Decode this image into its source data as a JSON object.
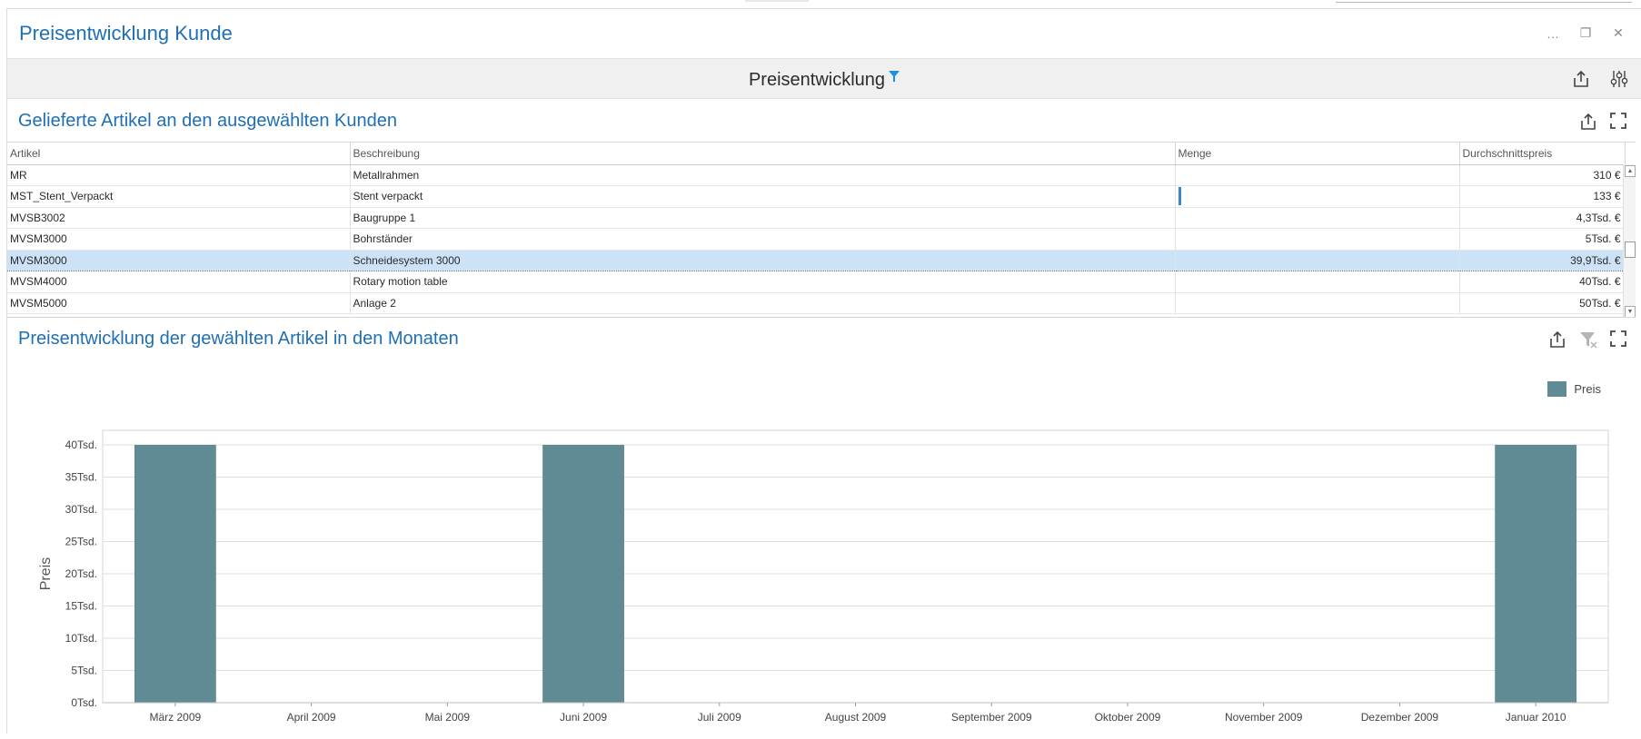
{
  "window": {
    "title": "Preisentwicklung Kunde",
    "controls": [
      "…",
      "❐",
      "✕"
    ]
  },
  "dashboard": {
    "title": "Preisentwicklung",
    "icons": [
      "filter-icon",
      "export-icon",
      "parameters-icon"
    ]
  },
  "grid_panel": {
    "title": "Gelieferte Artikel an den ausgewählten Kunden",
    "columns": [
      "Artikel",
      "Beschreibung",
      "Menge",
      "Durchschnittspreis"
    ],
    "rows": [
      {
        "artikel": "MR",
        "beschreibung": "Metallrahmen",
        "menge": "",
        "preis": "310 €",
        "menge_bar": false,
        "selected": false
      },
      {
        "artikel": "MST_Stent_Verpackt",
        "beschreibung": "Stent verpackt",
        "menge": "",
        "preis": "133 €",
        "menge_bar": true,
        "selected": false
      },
      {
        "artikel": "MVSB3002",
        "beschreibung": "Baugruppe 1",
        "menge": "",
        "preis": "4,3Tsd. €",
        "menge_bar": false,
        "selected": false
      },
      {
        "artikel": "MVSM3000",
        "beschreibung": "Bohrständer",
        "menge": "",
        "preis": "5Tsd. €",
        "menge_bar": false,
        "selected": false
      },
      {
        "artikel": "MVSM3000",
        "beschreibung": "Schneidesystem 3000",
        "menge": "",
        "preis": "39,9Tsd. €",
        "menge_bar": false,
        "selected": true
      },
      {
        "artikel": "MVSM4000",
        "beschreibung": "Rotary motion table",
        "menge": "",
        "preis": "40Tsd. €",
        "menge_bar": false,
        "selected": false
      },
      {
        "artikel": "MVSM5000",
        "beschreibung": "Anlage 2",
        "menge": "",
        "preis": "50Tsd. €",
        "menge_bar": false,
        "selected": false
      }
    ]
  },
  "chart_panel": {
    "title": "Preisentwicklung der gewählten Artikel in den Monaten"
  },
  "colors": {
    "accent": "#1f6fb4",
    "bar": "#608b94",
    "selection": "#cce3f7"
  },
  "chart_data": {
    "type": "bar",
    "categories": [
      "März 2009",
      "April 2009",
      "Mai 2009",
      "Juni 2009",
      "Juli 2009",
      "August 2009",
      "September 2009",
      "Oktober 2009",
      "November 2009",
      "Dezember 2009",
      "Januar 2010"
    ],
    "series": [
      {
        "name": "Preis",
        "values": [
          40000,
          null,
          null,
          40000,
          null,
          null,
          null,
          null,
          null,
          null,
          40000
        ]
      }
    ],
    "title": "",
    "xlabel": "",
    "ylabel": "Preis",
    "ylim": [
      0,
      40000
    ],
    "yticks": [
      0,
      5000,
      10000,
      15000,
      20000,
      25000,
      30000,
      35000,
      40000
    ],
    "ytick_labels": [
      "0Tsd.",
      "5Tsd.",
      "10Tsd.",
      "15Tsd.",
      "20Tsd.",
      "25Tsd.",
      "30Tsd.",
      "35Tsd.",
      "40Tsd."
    ],
    "grid": true,
    "legend": "top-right"
  }
}
